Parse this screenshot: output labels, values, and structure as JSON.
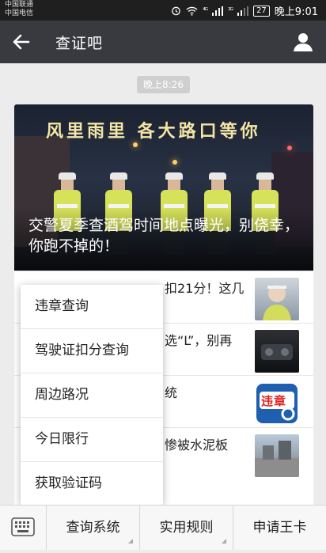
{
  "status_bar": {
    "carrier_1": "中国联通",
    "carrier_2": "中国电信",
    "signal_1": "⁴ᴳ",
    "signal_2": "²ᴳ",
    "battery": "27",
    "time": "晚上9:01"
  },
  "header": {
    "title": "查证吧",
    "back_icon": "back-arrow-icon",
    "profile_icon": "person-icon"
  },
  "chat": {
    "timestamp": "晚上8:26"
  },
  "article": {
    "hero_slogan": "风里雨里  各大路口等你",
    "hero_title": "交警夏季查酒驾时间地点曝光，别侥幸，你跑不掉的！",
    "rows": [
      {
        "text": "扣21分！这几"
      },
      {
        "text": "选“L”，别再"
      },
      {
        "text": "统"
      },
      {
        "text": "惨被水泥板"
      }
    ],
    "thumb3_label": "违章"
  },
  "popup_menu": {
    "items": [
      "违章查询",
      "驾驶证扣分查询",
      "周边路况",
      "今日限行",
      "获取验证码"
    ]
  },
  "bottom_menu": {
    "keyboard_icon": "keyboard-icon",
    "items": [
      "查询系统",
      "实用规则",
      "申请王卡"
    ]
  },
  "colors": {
    "title_bar": "#393a3f",
    "status_bar": "#1f1f1f",
    "background": "#ececec"
  }
}
